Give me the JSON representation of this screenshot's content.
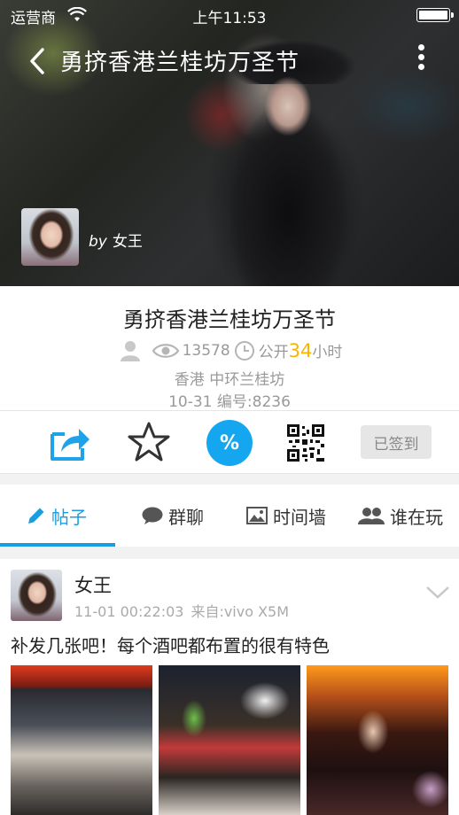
{
  "status_bar": {
    "carrier": "运营商",
    "time": "上午11:53"
  },
  "header": {
    "title": "勇挤香港兰桂坊万圣节"
  },
  "owner": {
    "by": "by",
    "name": "女王"
  },
  "event": {
    "title": "勇挤香港兰桂坊万圣节",
    "views": "13578",
    "visibility": "公开",
    "hours_value": "34",
    "hours_unit": "小时",
    "location": "香港 中环兰桂坊",
    "date_code": "10-31 编号:8236"
  },
  "actions": {
    "checkin_label": "已签到",
    "tag_symbol": "%"
  },
  "tabs": [
    {
      "label": "帖子"
    },
    {
      "label": "群聊"
    },
    {
      "label": "时间墙"
    },
    {
      "label": "谁在玩"
    }
  ],
  "post": {
    "author": "女王",
    "timestamp": "11-01 00:22:03",
    "source": "来自:vivo X5M",
    "text": "补发几张吧！每个酒吧都布置的很有特色"
  },
  "colors": {
    "accent": "#1a9ce0",
    "hours": "#f7b500",
    "tag_bg": "#14a7f0"
  }
}
